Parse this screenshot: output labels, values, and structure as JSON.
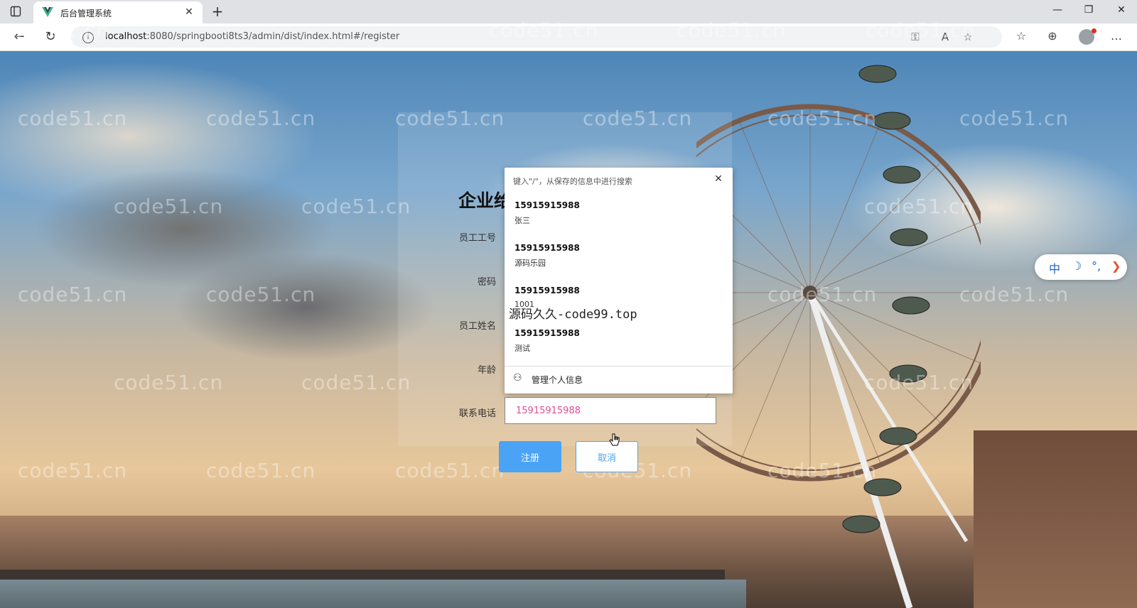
{
  "browser": {
    "tab_title": "后台管理系统",
    "tab_close": "✕",
    "new_tab": "+",
    "url_host": "localhost",
    "url_rest": ":8080/springbooti8ts3/admin/dist/index.html#/register",
    "window_controls": {
      "minimize": "—",
      "restore": "❐",
      "close": "✕"
    }
  },
  "watermark_text": "code51.cn",
  "overlay_watermark": "源码久久-code99.top",
  "form": {
    "title": "企业给",
    "labels": {
      "employee_id": "员工工号",
      "password": "密码",
      "employee_name": "员工姓名",
      "age": "年龄",
      "phone": "联系电话"
    },
    "phone_value": "15915915988",
    "register_button": "注册",
    "cancel_button": "取消"
  },
  "autofill": {
    "hint": "键入\"/\"，从保存的信息中进行搜索",
    "close": "✕",
    "suggestions": [
      {
        "phone": "15915915988",
        "name": "张三"
      },
      {
        "phone": "15915915988",
        "name": "源码乐园"
      },
      {
        "phone": "15915915988",
        "name": "1001"
      },
      {
        "phone": "15915915988",
        "name": "测试"
      }
    ],
    "manage_label": "管理个人信息"
  },
  "ime": {
    "lang": "中",
    "moon": "☽",
    "punct": "°,",
    "arrow": "❯"
  },
  "colors": {
    "primary": "#4aa3f5",
    "input_text": "#e04e98"
  }
}
